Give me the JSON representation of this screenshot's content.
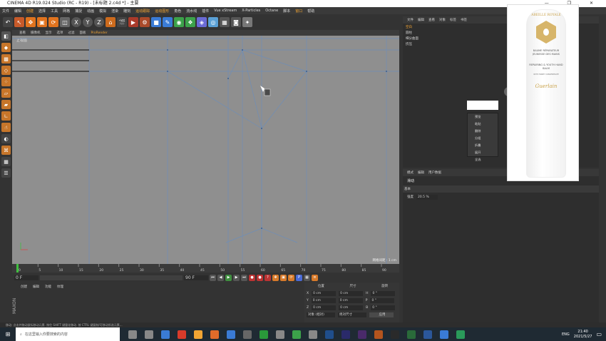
{
  "window": {
    "title": "CINEMA 4D R19.024 Studio (RC - R19) - [未标题 2.c4d *] - 主要",
    "controls": [
      "—",
      "❐",
      "✕"
    ]
  },
  "menubar": {
    "items": [
      "文件",
      "编辑",
      "创建",
      "选择",
      "工具",
      "网格",
      "捕捉",
      "动画",
      "模拟",
      "渲染",
      "雕刻",
      "运动跟踪",
      "运动图形",
      "角色",
      "流水线",
      "插件",
      "Vue xStream",
      "X-Particles",
      "Octane",
      "脚本",
      "窗口",
      "帮助"
    ],
    "highlighted": [
      "创建",
      "运动跟踪",
      "运动图形",
      "窗口"
    ]
  },
  "toolbar": {
    "icons": [
      "undo-icon",
      "pointer-icon",
      "move-icon",
      "scale-icon",
      "rotate-icon",
      "select-icon",
      "x-axis-icon",
      "y-axis-icon",
      "z-axis-icon",
      "world-icon",
      "render-view-icon",
      "render-icon",
      "render-settings-icon",
      "cube-icon",
      "pen-icon",
      "subdivide-icon",
      "array-icon",
      "deformer-icon",
      "field-icon",
      "scene-icon",
      "camera-icon",
      "light-icon"
    ],
    "axis_labels": [
      "X",
      "Y",
      "Z"
    ]
  },
  "viewport": {
    "menu": [
      "查看",
      "摄像机",
      "显示",
      "选项",
      "过滤",
      "面板",
      "ProRender"
    ],
    "name": "正视图",
    "grid_label": "网格间距 : 1 cm"
  },
  "timeline": {
    "ticks": [
      "0",
      "5",
      "10",
      "15",
      "20",
      "25",
      "30",
      "35",
      "40",
      "45",
      "50",
      "55",
      "60",
      "65",
      "70",
      "75",
      "80",
      "85",
      "90"
    ],
    "end_frame": "0 F"
  },
  "timectrl": {
    "start": "0 F",
    "current": "0 F",
    "end": "90 F",
    "end2": "90 F"
  },
  "material": {
    "tabs": [
      "创建",
      "编辑",
      "功能",
      "纹理"
    ]
  },
  "coords": {
    "headers": [
      "位置",
      "尺寸",
      "旋转"
    ],
    "rows": [
      {
        "axis": "X",
        "pos": "0 cm",
        "size": "0 cm",
        "rot_label": "H",
        "rot": "0 °"
      },
      {
        "axis": "Y",
        "pos": "0 cm",
        "size": "0 cm",
        "rot_label": "P",
        "rot": "0 °"
      },
      {
        "axis": "Z",
        "pos": "0 cm",
        "size": "0 cm",
        "rot_label": "B",
        "rot": "0 °"
      }
    ],
    "mode": "对象 (相对)",
    "size_mode": "绝对尺寸",
    "apply": "应用"
  },
  "objects": {
    "tabs": [
      "文件",
      "编辑",
      "查看",
      "对象",
      "标签",
      "书签"
    ],
    "items": [
      "空白",
      "圆柱",
      "细分曲面",
      "挤压"
    ]
  },
  "attributes": {
    "tabs": [
      "模式",
      "编辑",
      "用户数据"
    ],
    "title": "滑动",
    "section": "基本",
    "field_label": "强度",
    "field_value": "20.5 %"
  },
  "context_menu": {
    "items": [
      "预览",
      "粘贴",
      "删除",
      "分组",
      "折叠",
      "展开",
      "全选"
    ]
  },
  "ad": {
    "brand": "ABEILLE ROYALE",
    "line1": "BAUME RÉPARATEUR JEUNESSE DES MAINS",
    "line2": "REPAIRING & YOUTH HAND BALM",
    "line3": "WITH HONEY CONCENTRATE",
    "maker": "Guerlain"
  },
  "status": {
    "text": "移动: 点击并拖动鼠标移动元素. 按住 SHIFT 键量化移动. 按 CTRL 键复制/可移动所选元素..."
  },
  "taskbar": {
    "search_placeholder": "在这里输入你要搜索的内容",
    "time": "21:40",
    "date": "2021/5/27",
    "lang": "ENG"
  },
  "colors": {
    "accent": "#f2a533",
    "grid": "#6e8eb8"
  }
}
